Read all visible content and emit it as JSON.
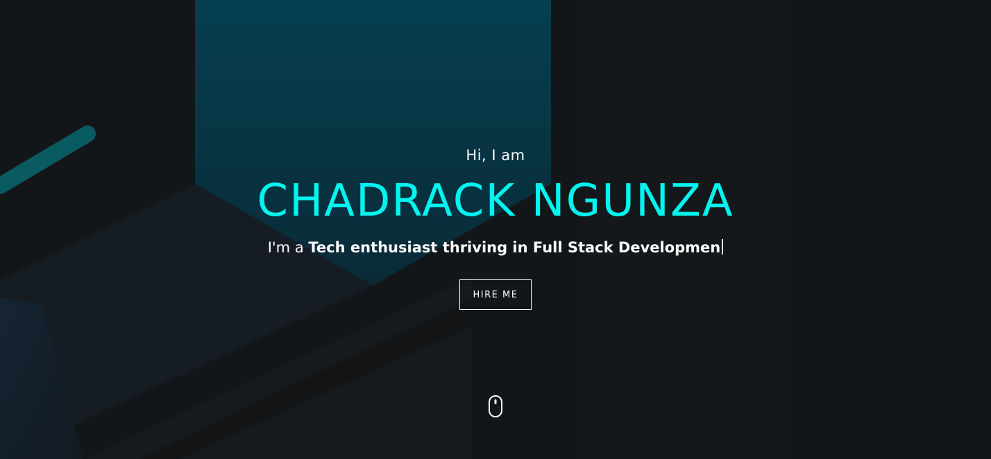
{
  "hero": {
    "greeting": "Hi, I am",
    "name": "CHADRACK NGUNZA",
    "tagline_prefix": "I'm a ",
    "tagline_role": "Tech enthusiast thriving in Full Stack Developmen",
    "hire_button": "HIRE ME"
  },
  "icons": {
    "scroll": "mouse-scroll-icon"
  },
  "colors": {
    "background": "#131618",
    "accent": "#00f5f0",
    "text": "#ffffff"
  }
}
